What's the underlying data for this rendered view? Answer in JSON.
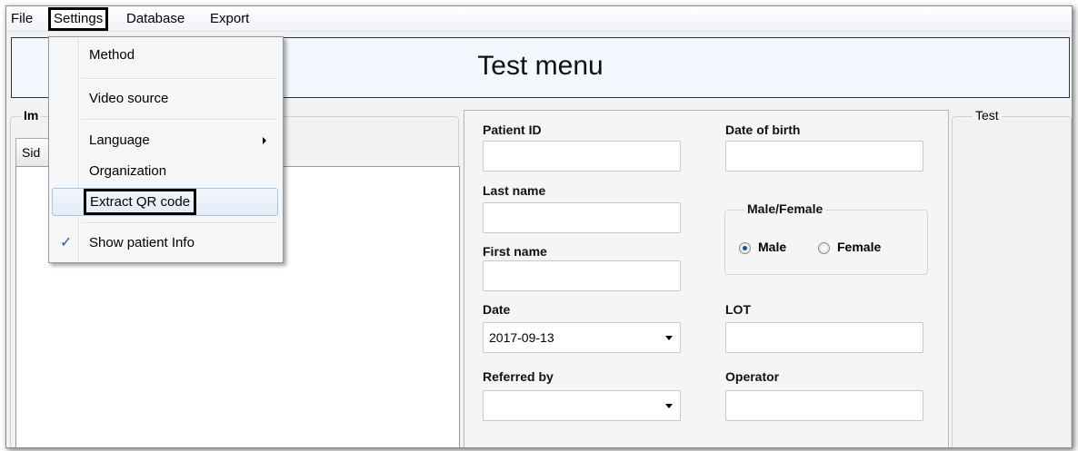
{
  "menubar": {
    "items": [
      "File",
      "Settings",
      "Database",
      "Export"
    ]
  },
  "header": {
    "title": "Test menu"
  },
  "left_group": {
    "label": "Im",
    "tab": "Sid"
  },
  "right_group": {
    "label": "Test"
  },
  "form": {
    "patient_id_label": "Patient ID",
    "patient_id_value": "",
    "dob_label": "Date of birth",
    "dob_value": "",
    "last_name_label": "Last name",
    "last_name_value": "",
    "first_name_label": "First name",
    "first_name_value": "",
    "gender_label": "Male/Female",
    "gender_options": [
      "Male",
      "Female"
    ],
    "gender_selected": "Male",
    "date_label": "Date",
    "date_value": "2017-09-13",
    "lot_label": "LOT",
    "lot_value": "",
    "referred_label": "Referred by",
    "referred_value": "",
    "operator_label": "Operator",
    "operator_value": ""
  },
  "settings_menu": {
    "items": [
      {
        "label": "Method"
      },
      {
        "label": "Video source"
      },
      {
        "label": "Language",
        "submenu": true
      },
      {
        "label": "Organization"
      },
      {
        "label": "Extract QR code",
        "highlighted": true
      },
      {
        "label": "Show patient Info",
        "checked": true
      }
    ],
    "check_glyph": "✓"
  },
  "colors": {
    "accent": "#1f5ba8",
    "header_bg": "#f3f8ff"
  }
}
